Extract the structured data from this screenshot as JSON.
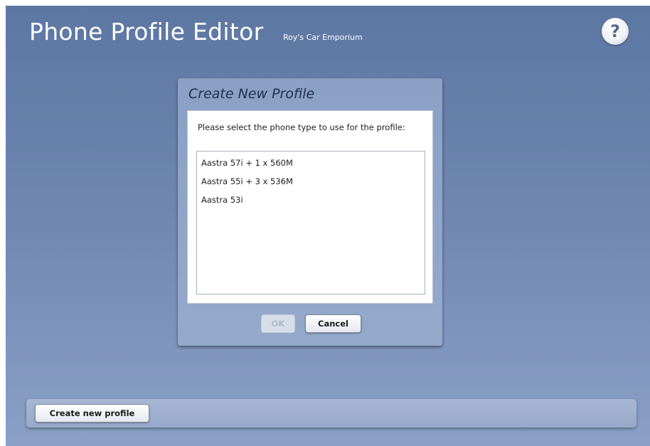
{
  "header": {
    "title": "Phone Profile Editor",
    "subtitle": "Roy's Car Emporium",
    "help_label": "?"
  },
  "dialog": {
    "title": "Create New Profile",
    "prompt": "Please select the phone type to use for the profile:",
    "phone_types": [
      "Aastra 57i + 1 x 560M",
      "Aastra 55i + 3 x 536M",
      "Aastra 53i"
    ],
    "ok_label": "OK",
    "ok_enabled": false,
    "cancel_label": "Cancel"
  },
  "footer": {
    "create_label": "Create new profile"
  }
}
